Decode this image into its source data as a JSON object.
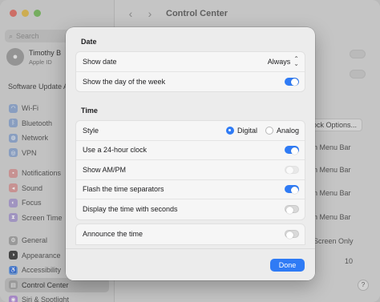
{
  "sidebar": {
    "search_placeholder": "Search",
    "user": {
      "name": "Timothy B",
      "subtitle": "Apple ID"
    },
    "software_update": "Software Update A",
    "groups": [
      [
        {
          "label": "Wi-Fi",
          "icon": "wifi-icon",
          "color": "#8da7d0",
          "glyph": "◠"
        },
        {
          "label": "Bluetooth",
          "icon": "bluetooth-icon",
          "color": "#8da7d0",
          "glyph": "ᛒ"
        },
        {
          "label": "Network",
          "icon": "globe-icon",
          "color": "#8da7d0",
          "glyph": "◍"
        },
        {
          "label": "VPN",
          "icon": "vpn-icon",
          "color": "#8da7d0",
          "glyph": "◎"
        }
      ],
      [
        {
          "label": "Notifications",
          "icon": "bell-icon",
          "color": "#d89898",
          "glyph": "▪"
        },
        {
          "label": "Sound",
          "icon": "speaker-icon",
          "color": "#d89898",
          "glyph": "◂"
        },
        {
          "label": "Focus",
          "icon": "moon-icon",
          "color": "#a99ad0",
          "glyph": "◐"
        },
        {
          "label": "Screen Time",
          "icon": "hourglass-icon",
          "color": "#a99ad0",
          "glyph": "⧗"
        }
      ],
      [
        {
          "label": "General",
          "icon": "gear-icon",
          "color": "#a0a0a0",
          "glyph": "⚙"
        },
        {
          "label": "Appearance",
          "icon": "appearance-icon",
          "color": "#3a3a3a",
          "glyph": "◑"
        },
        {
          "label": "Accessibility",
          "icon": "accessibility-icon",
          "color": "#6b9be0",
          "glyph": "♿"
        },
        {
          "label": "Control Center",
          "icon": "control-center-icon",
          "color": "#a0a0a0",
          "glyph": "▤",
          "active": true
        },
        {
          "label": "Siri & Spotlight",
          "icon": "siri-icon",
          "color": "#b08ad6",
          "glyph": "◉"
        }
      ]
    ]
  },
  "header": {
    "title": "Control Center"
  },
  "background": {
    "clock_options": "ock Options...",
    "menu_bar_1": "n Menu Bar",
    "menu_bar_2": "n Menu Bar",
    "menu_bar_3": "n Menu Bar",
    "menu_bar_4": "n Menu Bar",
    "screen_only": "Screen Only",
    "number": "10"
  },
  "sheet": {
    "date": {
      "title": "Date",
      "show_date_label": "Show date",
      "show_date_value": "Always",
      "day_of_week_label": "Show the day of the week",
      "day_of_week_on": true
    },
    "time": {
      "title": "Time",
      "style_label": "Style",
      "style_options": [
        "Digital",
        "Analog"
      ],
      "style_selected": "Digital",
      "rows": [
        {
          "label": "Use a 24-hour clock",
          "state": "on"
        },
        {
          "label": "Show AM/PM",
          "state": "disabled"
        },
        {
          "label": "Flash the time separators",
          "state": "on"
        },
        {
          "label": "Display the time with seconds",
          "state": "off"
        }
      ],
      "announce_label": "Announce the time",
      "announce_state": "off"
    },
    "done_label": "Done"
  }
}
